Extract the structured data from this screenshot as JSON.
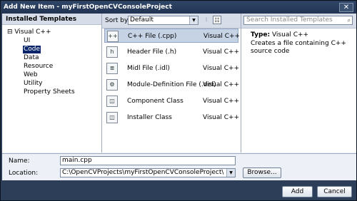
{
  "window": {
    "title": "Add New Item - myFirstOpenCVConsoleProject",
    "close_glyph": "✕"
  },
  "left": {
    "header": "Installed Templates",
    "root": {
      "expander": "⊟",
      "label": "Visual C++"
    },
    "items": [
      "UI",
      "Code",
      "Data",
      "Resource",
      "Web",
      "Utility",
      "Property Sheets"
    ],
    "selected": "Code"
  },
  "toolbar": {
    "sort_label": "Sort by:",
    "sort_value": "Default",
    "dropdown_glyph": "▼"
  },
  "templates": [
    {
      "name": "C++ File (.cpp)",
      "lang": "Visual C++",
      "icon": "cpp-file-icon",
      "glyph": "++"
    },
    {
      "name": "Header File (.h)",
      "lang": "Visual C++",
      "icon": "header-file-icon",
      "glyph": "h"
    },
    {
      "name": "Midl File (.idl)",
      "lang": "Visual C++",
      "icon": "midl-file-icon",
      "glyph": "≣"
    },
    {
      "name": "Module-Definition File (.def)",
      "lang": "Visual C++",
      "icon": "def-file-icon",
      "glyph": "⚙"
    },
    {
      "name": "Component Class",
      "lang": "Visual C++",
      "icon": "component-class-icon",
      "glyph": "◫"
    },
    {
      "name": "Installer Class",
      "lang": "Visual C++",
      "icon": "installer-class-icon",
      "glyph": "◫"
    }
  ],
  "details": {
    "search_placeholder": "Search Installed Templates",
    "type_label": "Type:",
    "type_value": "Visual C++",
    "description": "Creates a file containing C++ source code"
  },
  "form": {
    "name_label": "Name:",
    "name_value": "main.cpp",
    "location_label": "Location:",
    "location_value": "C:\\OpenCVProjects\\myFirstOpenCVConsoleProject\\",
    "browse_label": "Browse..."
  },
  "buttons": {
    "add": "Add",
    "cancel": "Cancel"
  },
  "colors": {
    "frame": "#2d3e58",
    "selection": "#0a246a",
    "row_selected": "#c6d3e5"
  }
}
